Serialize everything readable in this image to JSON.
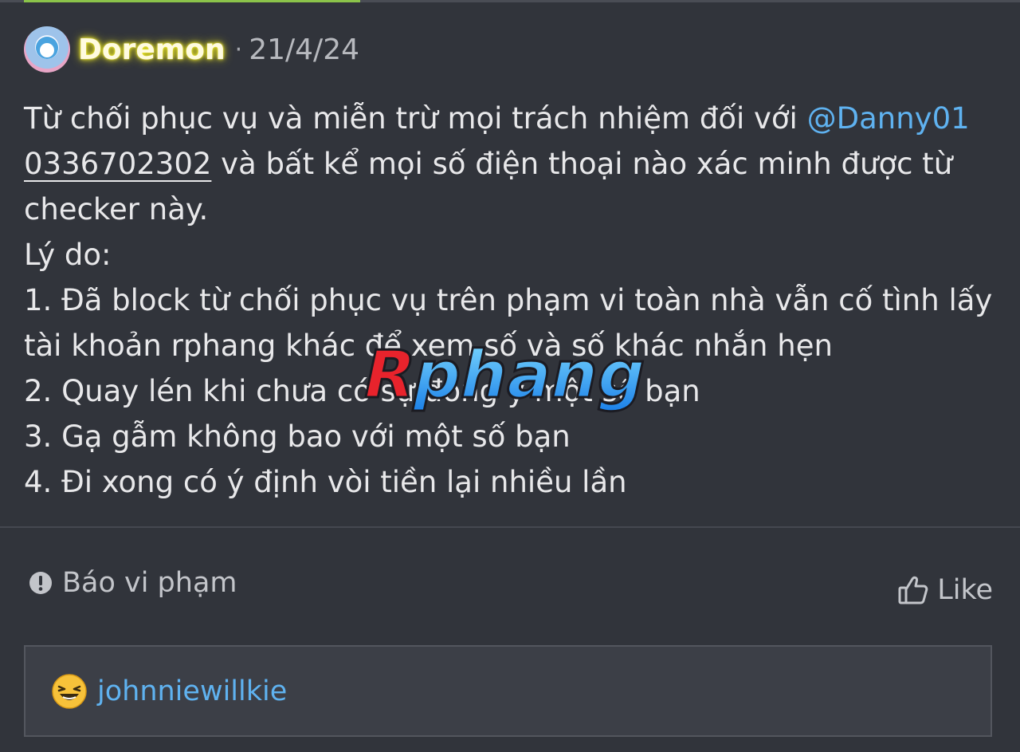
{
  "post": {
    "author": "Doremon",
    "separator": "·",
    "date": "21/4/24",
    "message": {
      "line1_text": "Từ chối phục vụ và miễn trừ mọi trách nhiệm đối với ",
      "mention": "@Danny01",
      "phone": "0336702302",
      "line2_rest": " và bất kể mọi số điện thoại nào xác minh được từ",
      "line3": "checker này.",
      "line4": "Lý do:",
      "line5": "1. Đã block từ chối phục vụ trên phạm vi toàn nhà vẫn cố tình lấy",
      "line6": "tài khoản rphang khác để xem số và số khác nhắn hẹn",
      "line7": "2. Quay lén khi chưa có sự đồng ý một số bạn",
      "line8": "3. Gạ gẫm không bao với một số bạn",
      "line9": "4. Đi xong có ý định vòi tiền lại nhiều lần"
    },
    "watermark": "Rphang"
  },
  "actions": {
    "report_label": "Báo vi phạm",
    "like_label": "Like"
  },
  "likes": {
    "user": "johnniewillkie"
  },
  "colors": {
    "background": "#31343b",
    "accent_bar": "#8bc34a",
    "link": "#5fb2f0",
    "username_glow": "#f2ee2a"
  },
  "icons": {
    "report": "exclamation-circle-icon",
    "like": "thumbs-up-icon",
    "reaction": "laughing-emoji-icon"
  }
}
